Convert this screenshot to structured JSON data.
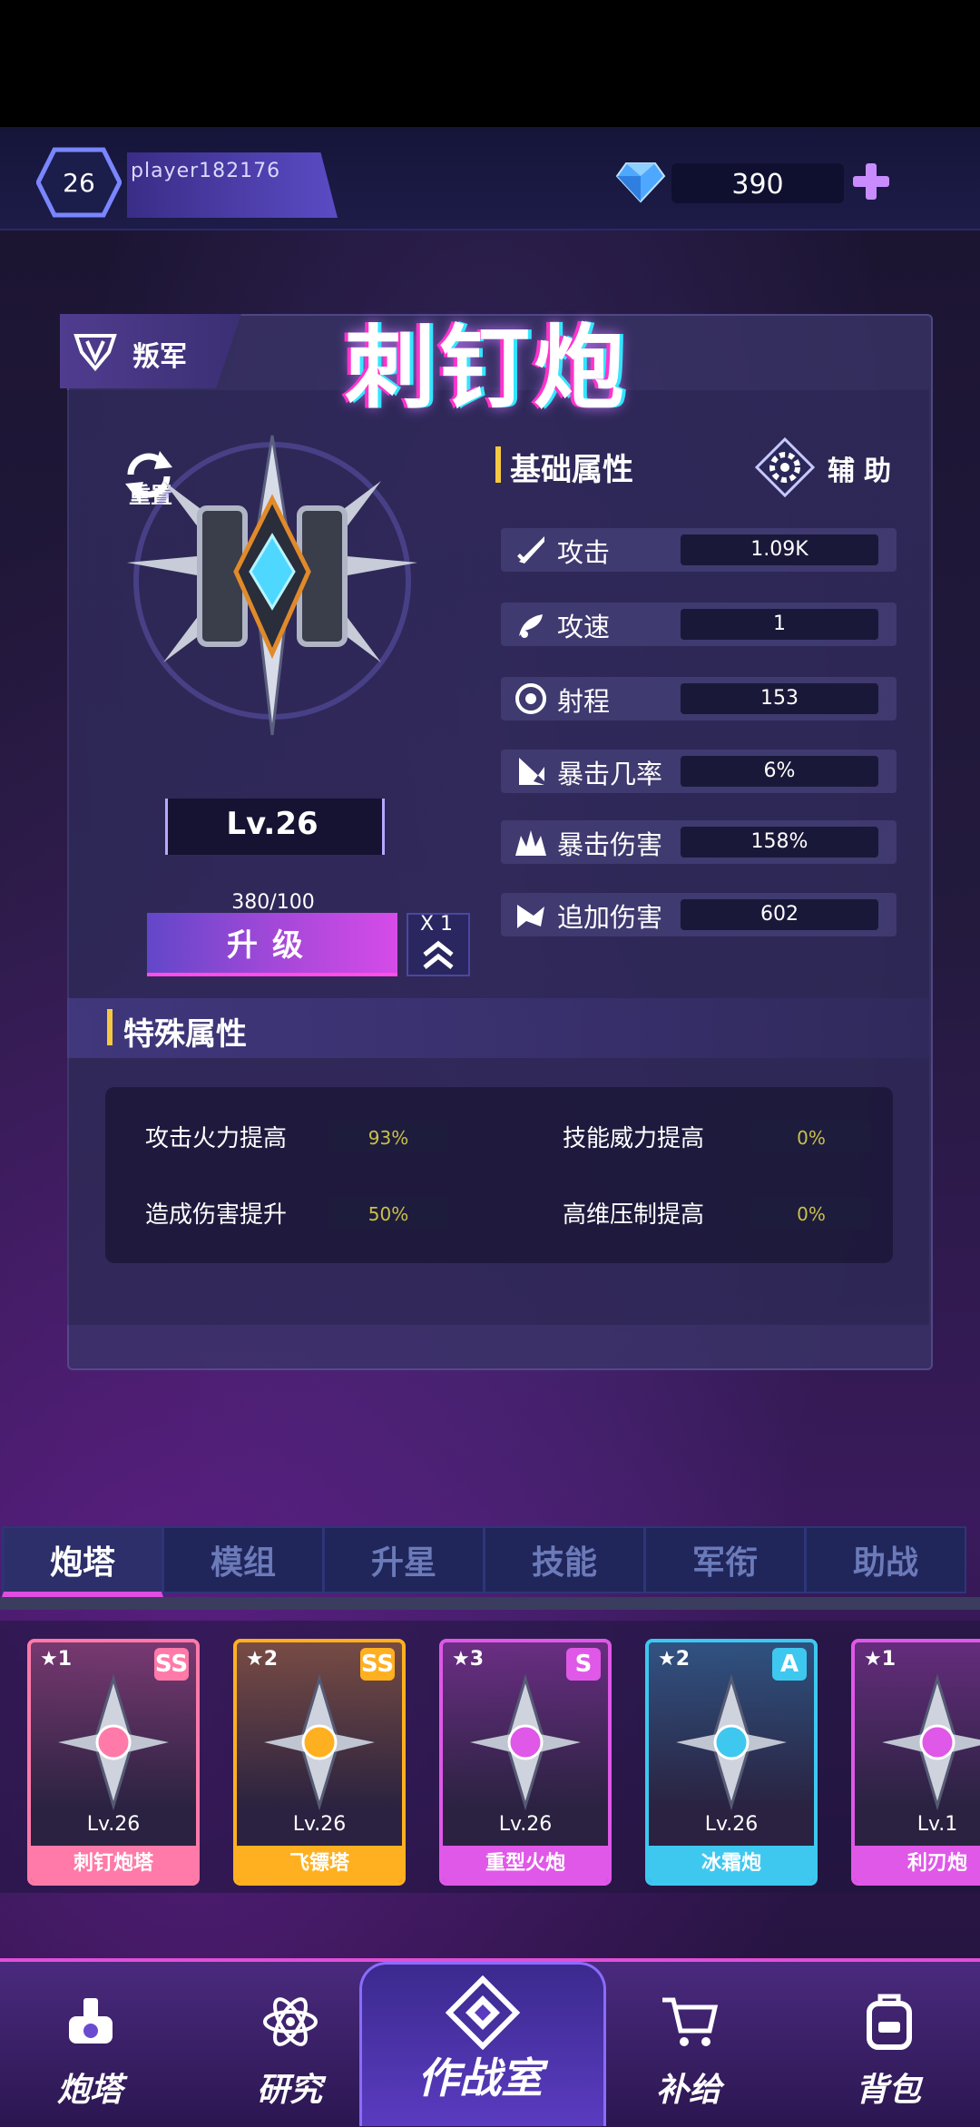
{
  "header": {
    "level": "26",
    "player_name": "player182176",
    "gems": "390"
  },
  "tower": {
    "faction": "叛军",
    "name": "刺钉炮",
    "reset_label": "重置",
    "level_label": "Lv.26",
    "exp": "380/100",
    "upgrade_label": "升级",
    "multiplier": "X 1"
  },
  "base_attrs": {
    "title": "基础属性",
    "assist_label": "辅助",
    "rows": [
      {
        "label": "攻击",
        "value": "1.09K",
        "icon": "sword-icon"
      },
      {
        "label": "攻速",
        "value": "1",
        "icon": "speed-icon"
      },
      {
        "label": "射程",
        "value": "153",
        "icon": "target-icon"
      },
      {
        "label": "暴击几率",
        "value": "6%",
        "icon": "crit-arrow-icon"
      },
      {
        "label": "暴击伤害",
        "value": "158%",
        "icon": "crit-burst-icon"
      },
      {
        "label": "追加伤害",
        "value": "602",
        "icon": "extra-damage-icon"
      }
    ]
  },
  "special_attrs": {
    "title": "特殊属性",
    "rows": [
      {
        "label": "攻击火力提高",
        "value": "93%"
      },
      {
        "label": "技能威力提高",
        "value": "0%"
      },
      {
        "label": "造成伤害提升",
        "value": "50%"
      },
      {
        "label": "高维压制提高",
        "value": "0%"
      }
    ]
  },
  "tabs": [
    "炮塔",
    "模组",
    "升星",
    "技能",
    "军衔",
    "助战"
  ],
  "cards": [
    {
      "stars": "★1",
      "grade": "SS",
      "level": "Lv.26",
      "name": "刺钉炮塔",
      "color": "#ff7aa8"
    },
    {
      "stars": "★2",
      "grade": "SS",
      "level": "Lv.26",
      "name": "飞镖塔",
      "color": "#ffb020"
    },
    {
      "stars": "★3",
      "grade": "S",
      "level": "Lv.26",
      "name": "重型火炮",
      "color": "#e058e8"
    },
    {
      "stars": "★2",
      "grade": "A",
      "level": "Lv.26",
      "name": "冰霜炮",
      "color": "#3ec8f0"
    },
    {
      "stars": "★1",
      "grade": "",
      "level": "Lv.1",
      "name": "利刃炮",
      "color": "#e058e8"
    }
  ],
  "bottom_nav": [
    "炮塔",
    "研究",
    "作战室",
    "补给",
    "背包"
  ],
  "colors": {
    "accent_pink": "#e24ed8",
    "section_bar": "#f5c842",
    "special_value": "#c9c04a"
  }
}
